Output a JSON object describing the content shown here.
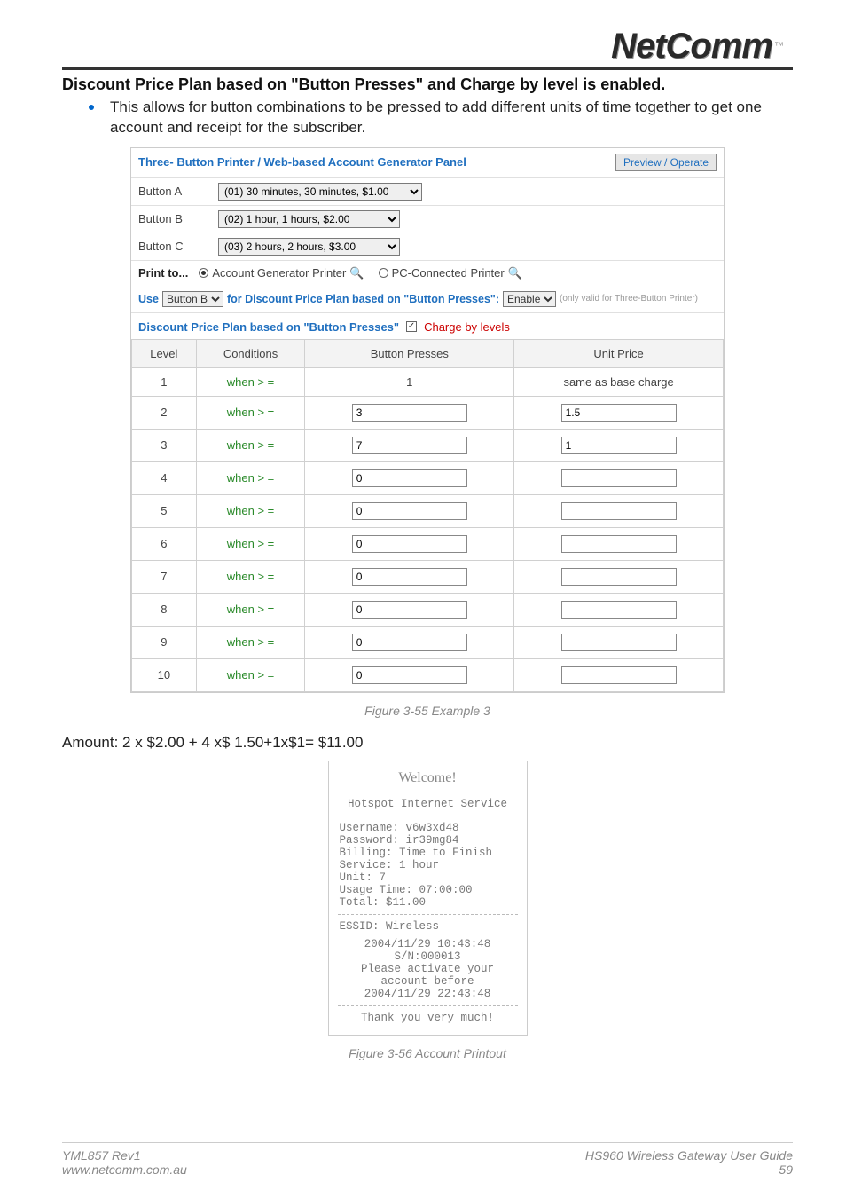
{
  "logo": {
    "text": "NetComm",
    "tm": "™"
  },
  "section_title": "Discount Price Plan based on \"Button Presses\" and Charge by level is enabled.",
  "bullet": "This allows for button combinations to be pressed to add different units of time together to get one account and receipt for the subscriber.",
  "panel": {
    "title": "Three- Button Printer / Web-based Account Generator Panel",
    "preview_btn": "Preview / Operate",
    "row_a": {
      "label": "Button A",
      "value": "(01) 30 minutes, 30 minutes, $1.00"
    },
    "row_b": {
      "label": "Button B",
      "value": "(02) 1 hour, 1 hours, $2.00"
    },
    "row_c": {
      "label": "Button C",
      "value": "(03) 2 hours, 2 hours, $3.00"
    },
    "print": {
      "label": "Print to...",
      "opt1": "Account Generator Printer",
      "opt2": "PC-Connected Printer"
    },
    "use": {
      "prefix": "Use",
      "sel": "Button B",
      "mid": "for Discount Price Plan based on \"Button Presses\":",
      "sel2": "Enable",
      "note": "(only valid for Three-Button Printer)"
    },
    "sub": {
      "title": "Discount Price Plan based on \"Button Presses\"",
      "charge": "Charge by levels"
    },
    "th": {
      "level": "Level",
      "cond": "Conditions",
      "bp": "Button Presses",
      "up": "Unit Price"
    },
    "rows": [
      {
        "level": "1",
        "cond": "when > =",
        "bp_text": "1",
        "up_text": "same as base charge"
      },
      {
        "level": "2",
        "cond": "when > =",
        "bp": "3",
        "up": "1.5"
      },
      {
        "level": "3",
        "cond": "when > =",
        "bp": "7",
        "up": "1"
      },
      {
        "level": "4",
        "cond": "when > =",
        "bp": "0",
        "up": ""
      },
      {
        "level": "5",
        "cond": "when > =",
        "bp": "0",
        "up": ""
      },
      {
        "level": "6",
        "cond": "when > =",
        "bp": "0",
        "up": ""
      },
      {
        "level": "7",
        "cond": "when > =",
        "bp": "0",
        "up": ""
      },
      {
        "level": "8",
        "cond": "when > =",
        "bp": "0",
        "up": ""
      },
      {
        "level": "9",
        "cond": "when > =",
        "bp": "0",
        "up": ""
      },
      {
        "level": "10",
        "cond": "when > =",
        "bp": "0",
        "up": ""
      }
    ]
  },
  "figcap1": "Figure 3-55 Example 3",
  "amount": "Amount: 2 x $2.00 + 4 x$ 1.50+1x$1= $11.00",
  "receipt": {
    "title": "Welcome!",
    "svc": "Hotspot Internet Service",
    "u": "Username:  v6w3xd48",
    "p": "Password:  ir39mg84",
    "b": "Billing: Time to Finish",
    "s": "Service: 1 hour",
    "unit": "Unit: 7",
    "usage": "Usage Time: 07:00:00",
    "total": "Total: $11.00",
    "essid": "ESSID: Wireless",
    "ts1": "2004/11/29 10:43:48",
    "sn": "S/N:000013",
    "act1": "Please activate your",
    "act2": "account before",
    "ts2": "2004/11/29 22:43:48",
    "thanks": "Thank you very much!"
  },
  "figcap2": "Figure 3-56 Account Printout",
  "footer": {
    "left1": "YML857 Rev1",
    "left2": "www.netcomm.com.au",
    "right1": "HS960 Wireless Gateway User Guide",
    "right2": "59"
  }
}
